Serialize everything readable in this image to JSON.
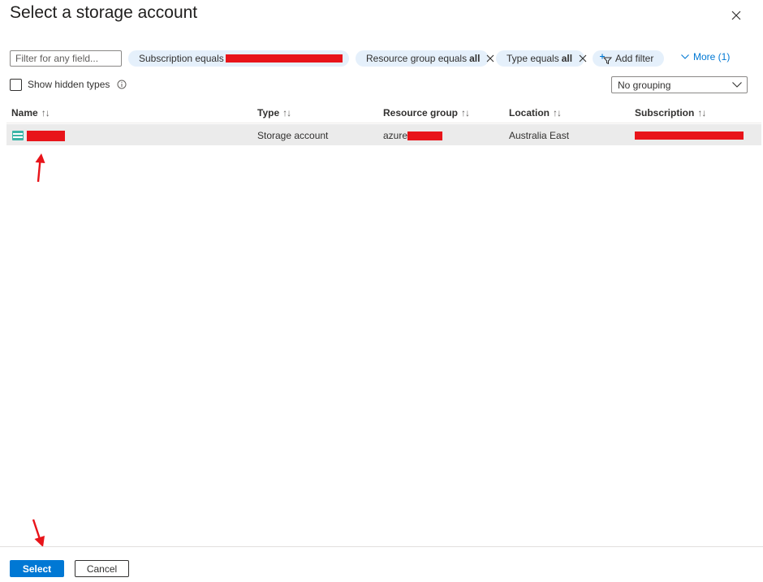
{
  "dialog": {
    "title": "Select a storage account",
    "close_icon": "close-icon"
  },
  "filters": {
    "search_placeholder": "Filter for any field...",
    "pills": [
      {
        "label": "Subscription equals",
        "value": ""
      },
      {
        "label": "Resource group equals",
        "value": "all"
      },
      {
        "label": "Type equals",
        "value": "all"
      }
    ],
    "add_filter_label": "Add filter",
    "more_label": "More (1)"
  },
  "options": {
    "show_hidden_label": "Show hidden types",
    "show_hidden_checked": false,
    "grouping_value": "No grouping"
  },
  "table": {
    "columns": [
      "Name",
      "Type",
      "Resource group",
      "Location",
      "Subscription"
    ],
    "sort_glyph": "↑↓",
    "rows": [
      {
        "name": "",
        "type": "Storage account",
        "resource_group_prefix": "azure",
        "location": "Australia East",
        "subscription": ""
      }
    ]
  },
  "footer": {
    "select_label": "Select",
    "cancel_label": "Cancel"
  },
  "colors": {
    "accent": "#0078d4",
    "pill_bg": "#e5f0fb",
    "redaction": "#e8141a",
    "selected_row": "#ebebeb"
  }
}
